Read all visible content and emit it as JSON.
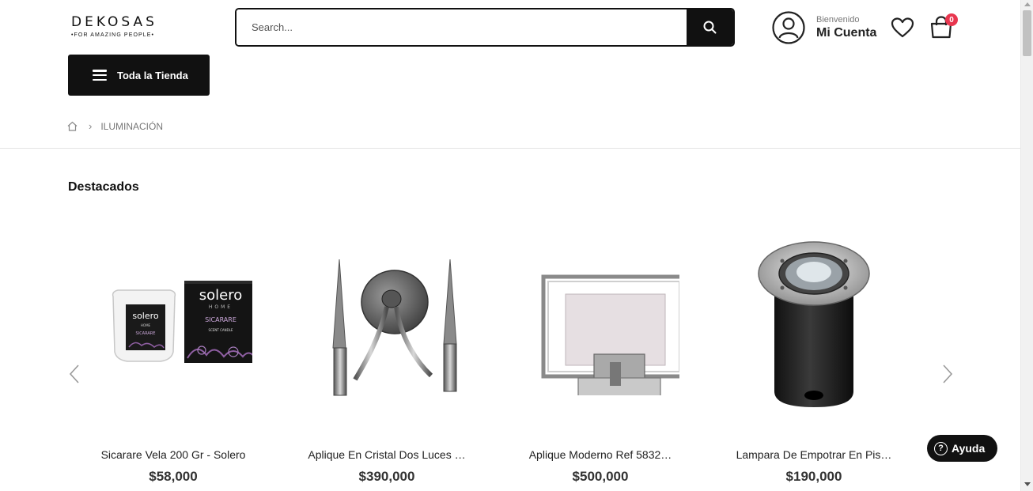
{
  "header": {
    "logo_text": "DEKOSAS",
    "logo_tagline": "•FOR AMAZING PEOPLE•",
    "search_placeholder": "Search...",
    "account_welcome": "Bienvenido",
    "account_name": "Mi Cuenta",
    "cart_count": "0",
    "all_store_label": "Toda la Tienda"
  },
  "breadcrumb": {
    "home_icon": "home-icon",
    "current": "ILUMINACIÓN"
  },
  "section": {
    "title": "Destacados"
  },
  "products": [
    {
      "name": "Sicarare Vela 200 Gr - Solero",
      "price": "$58,000"
    },
    {
      "name": "Aplique En Cristal Dos Luces …",
      "price": "$390,000"
    },
    {
      "name": "Aplique Moderno Ref 5832…",
      "price": "$500,000"
    },
    {
      "name": "Lampara De Empotrar En Pis…",
      "price": "$190,000"
    }
  ],
  "product_images": {
    "candle_brand": "solero",
    "candle_brand_sub": "HOME",
    "candle_name": "SICARARE",
    "candle_detail": "SCENT CANDLE"
  },
  "help": {
    "label": "Ayuda"
  },
  "colors": {
    "primary": "#111111",
    "badge": "#e8364f"
  }
}
